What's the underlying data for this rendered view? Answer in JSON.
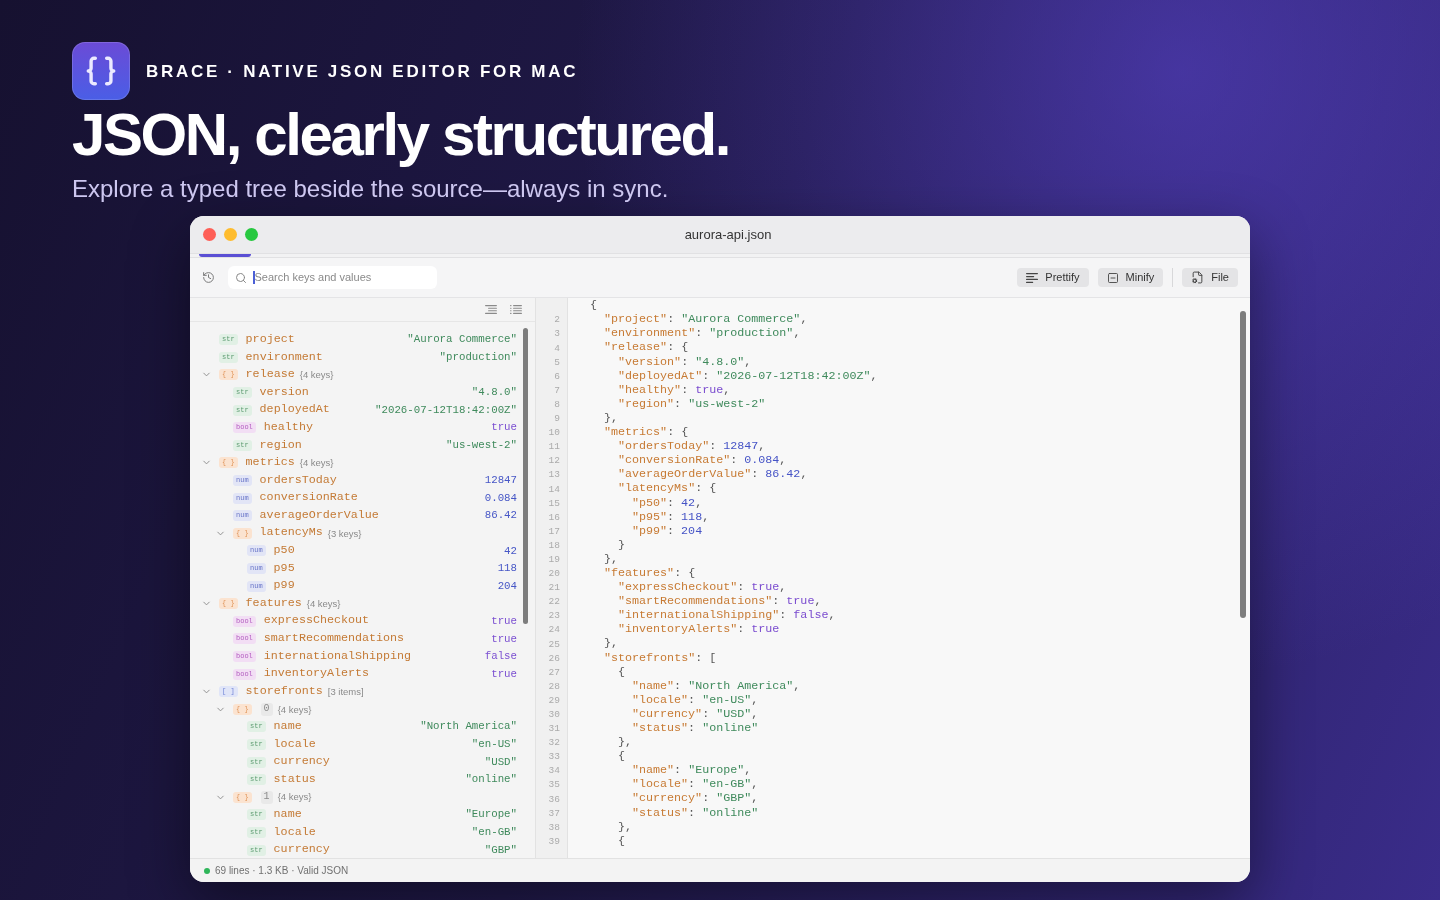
{
  "hero": {
    "brand": "BRACE · NATIVE JSON EDITOR FOR MAC",
    "headline": "JSON, clearly structured.",
    "subtitle": "Explore a typed tree beside the source—always in sync."
  },
  "window": {
    "title": "aurora-api.json"
  },
  "toolbar": {
    "search": {
      "placeholder": "Search keys and values",
      "focused": true
    },
    "buttons": [
      {
        "label": "Prettify",
        "kind": "prettify"
      },
      {
        "label": "Minify",
        "kind": "minify"
      }
    ],
    "file_button": {
      "label": "File",
      "kind": "file"
    }
  },
  "tree": {
    "items": [
      {
        "key": "project",
        "kind": "str",
        "badge": "str",
        "value": "\"Aurora Commerce\""
      },
      {
        "key": "environment",
        "kind": "str",
        "badge": "str",
        "value": "\"production\""
      },
      {
        "key": "release",
        "kind": "object",
        "badge": "{ }",
        "summary": "{4 keys}",
        "expanded": true,
        "children": [
          {
            "key": "version",
            "kind": "str",
            "badge": "str",
            "value": "\"4.8.0\""
          },
          {
            "key": "deployedAt",
            "kind": "str",
            "badge": "str",
            "value": "\"2026-07-12T18:42:00Z\""
          },
          {
            "key": "healthy",
            "kind": "bool",
            "badge": "bool",
            "value": "true"
          },
          {
            "key": "region",
            "kind": "str",
            "badge": "str",
            "value": "\"us-west-2\""
          }
        ]
      },
      {
        "key": "metrics",
        "kind": "object",
        "badge": "{ }",
        "summary": "{4 keys}",
        "expanded": true,
        "children": [
          {
            "key": "ordersToday",
            "kind": "num",
            "badge": "num",
            "value": "12847"
          },
          {
            "key": "conversionRate",
            "kind": "num",
            "badge": "num",
            "value": "0.084"
          },
          {
            "key": "averageOrderValue",
            "kind": "num",
            "badge": "num",
            "value": "86.42"
          },
          {
            "key": "latencyMs",
            "kind": "object",
            "badge": "{ }",
            "summary": "{3 keys}",
            "expanded": true,
            "children": [
              {
                "key": "p50",
                "kind": "num",
                "badge": "num",
                "value": "42"
              },
              {
                "key": "p95",
                "kind": "num",
                "badge": "num",
                "value": "118"
              },
              {
                "key": "p99",
                "kind": "num",
                "badge": "num",
                "value": "204"
              }
            ]
          }
        ]
      },
      {
        "key": "features",
        "kind": "object",
        "badge": "{ }",
        "summary": "{4 keys}",
        "expanded": true,
        "children": [
          {
            "key": "expressCheckout",
            "kind": "bool",
            "badge": "bool",
            "value": "true"
          },
          {
            "key": "smartRecommendations",
            "kind": "bool",
            "badge": "bool",
            "value": "true"
          },
          {
            "key": "internationalShipping",
            "kind": "bool",
            "badge": "bool",
            "value": "false"
          },
          {
            "key": "inventoryAlerts",
            "kind": "bool",
            "badge": "bool",
            "value": "true"
          }
        ]
      },
      {
        "key": "storefronts",
        "kind": "array",
        "badge": "[ ]",
        "summary": "[3 items]",
        "expanded": true,
        "children": [
          {
            "index": "0",
            "kind": "object",
            "badge": "{ }",
            "summary": "{4 keys}",
            "expanded": true,
            "children": [
              {
                "key": "name",
                "kind": "str",
                "badge": "str",
                "value": "\"North America\""
              },
              {
                "key": "locale",
                "kind": "str",
                "badge": "str",
                "value": "\"en-US\""
              },
              {
                "key": "currency",
                "kind": "str",
                "badge": "str",
                "value": "\"USD\""
              },
              {
                "key": "status",
                "kind": "str",
                "badge": "str",
                "value": "\"online\""
              }
            ]
          },
          {
            "index": "1",
            "kind": "object",
            "badge": "{ }",
            "summary": "{4 keys}",
            "expanded": true,
            "children": [
              {
                "key": "name",
                "kind": "str",
                "badge": "str",
                "value": "\"Europe\""
              },
              {
                "key": "locale",
                "kind": "str",
                "badge": "str",
                "value": "\"en-GB\""
              },
              {
                "key": "currency",
                "kind": "str",
                "badge": "str",
                "value": "\"GBP\""
              }
            ]
          }
        ]
      }
    ]
  },
  "code": {
    "lines": [
      {
        "tokens": [
          {
            "kind": "punct",
            "text": "{"
          }
        ],
        "children": [
          {
            "number": "2",
            "tokens": [
              {
                "kind": "key",
                "text": "\"project\""
              },
              {
                "kind": "punct",
                "text": ": "
              },
              {
                "kind": "str",
                "text": "\"Aurora Commerce\""
              },
              {
                "kind": "punct",
                "text": ","
              }
            ]
          },
          {
            "number": "3",
            "tokens": [
              {
                "kind": "key",
                "text": "\"environment\""
              },
              {
                "kind": "punct",
                "text": ": "
              },
              {
                "kind": "str",
                "text": "\"production\""
              },
              {
                "kind": "punct",
                "text": ","
              }
            ]
          },
          {
            "number": "4",
            "tokens": [
              {
                "kind": "key",
                "text": "\"release\""
              },
              {
                "kind": "punct",
                "text": ": {"
              }
            ],
            "children": [
              {
                "number": "5",
                "tokens": [
                  {
                    "kind": "key",
                    "text": "\"version\""
                  },
                  {
                    "kind": "punct",
                    "text": ": "
                  },
                  {
                    "kind": "str",
                    "text": "\"4.8.0\""
                  },
                  {
                    "kind": "punct",
                    "text": ","
                  }
                ]
              },
              {
                "number": "6",
                "tokens": [
                  {
                    "kind": "key",
                    "text": "\"deployedAt\""
                  },
                  {
                    "kind": "punct",
                    "text": ": "
                  },
                  {
                    "kind": "str",
                    "text": "\"2026-07-12T18:42:00Z\""
                  },
                  {
                    "kind": "punct",
                    "text": ","
                  }
                ]
              },
              {
                "number": "7",
                "tokens": [
                  {
                    "kind": "key",
                    "text": "\"healthy\""
                  },
                  {
                    "kind": "punct",
                    "text": ": "
                  },
                  {
                    "kind": "bool",
                    "text": "true"
                  },
                  {
                    "kind": "punct",
                    "text": ","
                  }
                ]
              },
              {
                "number": "8",
                "tokens": [
                  {
                    "kind": "key",
                    "text": "\"region\""
                  },
                  {
                    "kind": "punct",
                    "text": ": "
                  },
                  {
                    "kind": "str",
                    "text": "\"us-west-2\""
                  }
                ]
              }
            ]
          },
          {
            "number": "9",
            "tokens": [
              {
                "kind": "punct",
                "text": "},"
              }
            ]
          },
          {
            "number": "10",
            "tokens": [
              {
                "kind": "key",
                "text": "\"metrics\""
              },
              {
                "kind": "punct",
                "text": ": {"
              }
            ],
            "children": [
              {
                "number": "11",
                "tokens": [
                  {
                    "kind": "key",
                    "text": "\"ordersToday\""
                  },
                  {
                    "kind": "punct",
                    "text": ": "
                  },
                  {
                    "kind": "num",
                    "text": "12847"
                  },
                  {
                    "kind": "punct",
                    "text": ","
                  }
                ]
              },
              {
                "number": "12",
                "tokens": [
                  {
                    "kind": "key",
                    "text": "\"conversionRate\""
                  },
                  {
                    "kind": "punct",
                    "text": ": "
                  },
                  {
                    "kind": "num",
                    "text": "0.084"
                  },
                  {
                    "kind": "punct",
                    "text": ","
                  }
                ]
              },
              {
                "number": "13",
                "tokens": [
                  {
                    "kind": "key",
                    "text": "\"averageOrderValue\""
                  },
                  {
                    "kind": "punct",
                    "text": ": "
                  },
                  {
                    "kind": "num",
                    "text": "86.42"
                  },
                  {
                    "kind": "punct",
                    "text": ","
                  }
                ]
              },
              {
                "number": "14",
                "tokens": [
                  {
                    "kind": "key",
                    "text": "\"latencyMs\""
                  },
                  {
                    "kind": "punct",
                    "text": ": {"
                  }
                ],
                "children": [
                  {
                    "number": "15",
                    "tokens": [
                      {
                        "kind": "key",
                        "text": "\"p50\""
                      },
                      {
                        "kind": "punct",
                        "text": ": "
                      },
                      {
                        "kind": "num",
                        "text": "42"
                      },
                      {
                        "kind": "punct",
                        "text": ","
                      }
                    ]
                  },
                  {
                    "number": "16",
                    "tokens": [
                      {
                        "kind": "key",
                        "text": "\"p95\""
                      },
                      {
                        "kind": "punct",
                        "text": ": "
                      },
                      {
                        "kind": "num",
                        "text": "118"
                      },
                      {
                        "kind": "punct",
                        "text": ","
                      }
                    ]
                  },
                  {
                    "number": "17",
                    "tokens": [
                      {
                        "kind": "key",
                        "text": "\"p99\""
                      },
                      {
                        "kind": "punct",
                        "text": ": "
                      },
                      {
                        "kind": "num",
                        "text": "204"
                      }
                    ]
                  }
                ]
              },
              {
                "number": "18",
                "tokens": [
                  {
                    "kind": "punct",
                    "text": "}"
                  }
                ]
              }
            ]
          },
          {
            "number": "19",
            "tokens": [
              {
                "kind": "punct",
                "text": "},"
              }
            ]
          },
          {
            "number": "20",
            "tokens": [
              {
                "kind": "key",
                "text": "\"features\""
              },
              {
                "kind": "punct",
                "text": ": {"
              }
            ],
            "children": [
              {
                "number": "21",
                "tokens": [
                  {
                    "kind": "key",
                    "text": "\"expressCheckout\""
                  },
                  {
                    "kind": "punct",
                    "text": ": "
                  },
                  {
                    "kind": "bool",
                    "text": "true"
                  },
                  {
                    "kind": "punct",
                    "text": ","
                  }
                ]
              },
              {
                "number": "22",
                "tokens": [
                  {
                    "kind": "key",
                    "text": "\"smartRecommendations\""
                  },
                  {
                    "kind": "punct",
                    "text": ": "
                  },
                  {
                    "kind": "bool",
                    "text": "true"
                  },
                  {
                    "kind": "punct",
                    "text": ","
                  }
                ]
              },
              {
                "number": "23",
                "tokens": [
                  {
                    "kind": "key",
                    "text": "\"internationalShipping\""
                  },
                  {
                    "kind": "punct",
                    "text": ": "
                  },
                  {
                    "kind": "bool",
                    "text": "false"
                  },
                  {
                    "kind": "punct",
                    "text": ","
                  }
                ]
              },
              {
                "number": "24",
                "tokens": [
                  {
                    "kind": "key",
                    "text": "\"inventoryAlerts\""
                  },
                  {
                    "kind": "punct",
                    "text": ": "
                  },
                  {
                    "kind": "bool",
                    "text": "true"
                  }
                ]
              }
            ]
          },
          {
            "number": "25",
            "tokens": [
              {
                "kind": "punct",
                "text": "},"
              }
            ]
          },
          {
            "number": "26",
            "tokens": [
              {
                "kind": "key",
                "text": "\"storefronts\""
              },
              {
                "kind": "punct",
                "text": ": ["
              }
            ],
            "children": [
              {
                "number": "27",
                "tokens": [
                  {
                    "kind": "punct",
                    "text": "{"
                  }
                ],
                "children": [
                  {
                    "number": "28",
                    "tokens": [
                      {
                        "kind": "key",
                        "text": "\"name\""
                      },
                      {
                        "kind": "punct",
                        "text": ": "
                      },
                      {
                        "kind": "str",
                        "text": "\"North America\""
                      },
                      {
                        "kind": "punct",
                        "text": ","
                      }
                    ]
                  },
                  {
                    "number": "29",
                    "tokens": [
                      {
                        "kind": "key",
                        "text": "\"locale\""
                      },
                      {
                        "kind": "punct",
                        "text": ": "
                      },
                      {
                        "kind": "str",
                        "text": "\"en-US\""
                      },
                      {
                        "kind": "punct",
                        "text": ","
                      }
                    ]
                  },
                  {
                    "number": "30",
                    "tokens": [
                      {
                        "kind": "key",
                        "text": "\"currency\""
                      },
                      {
                        "kind": "punct",
                        "text": ": "
                      },
                      {
                        "kind": "str",
                        "text": "\"USD\""
                      },
                      {
                        "kind": "punct",
                        "text": ","
                      }
                    ]
                  },
                  {
                    "number": "31",
                    "tokens": [
                      {
                        "kind": "key",
                        "text": "\"status\""
                      },
                      {
                        "kind": "punct",
                        "text": ": "
                      },
                      {
                        "kind": "str",
                        "text": "\"online\""
                      }
                    ]
                  }
                ]
              },
              {
                "number": "32",
                "tokens": [
                  {
                    "kind": "punct",
                    "text": "},"
                  }
                ]
              },
              {
                "number": "33",
                "tokens": [
                  {
                    "kind": "punct",
                    "text": "{"
                  }
                ],
                "children": [
                  {
                    "number": "34",
                    "tokens": [
                      {
                        "kind": "key",
                        "text": "\"name\""
                      },
                      {
                        "kind": "punct",
                        "text": ": "
                      },
                      {
                        "kind": "str",
                        "text": "\"Europe\""
                      },
                      {
                        "kind": "punct",
                        "text": ","
                      }
                    ]
                  },
                  {
                    "number": "35",
                    "tokens": [
                      {
                        "kind": "key",
                        "text": "\"locale\""
                      },
                      {
                        "kind": "punct",
                        "text": ": "
                      },
                      {
                        "kind": "str",
                        "text": "\"en-GB\""
                      },
                      {
                        "kind": "punct",
                        "text": ","
                      }
                    ]
                  },
                  {
                    "number": "36",
                    "tokens": [
                      {
                        "kind": "key",
                        "text": "\"currency\""
                      },
                      {
                        "kind": "punct",
                        "text": ": "
                      },
                      {
                        "kind": "str",
                        "text": "\"GBP\""
                      },
                      {
                        "kind": "punct",
                        "text": ","
                      }
                    ]
                  },
                  {
                    "number": "37",
                    "tokens": [
                      {
                        "kind": "key",
                        "text": "\"status\""
                      },
                      {
                        "kind": "punct",
                        "text": ": "
                      },
                      {
                        "kind": "str",
                        "text": "\"online\""
                      }
                    ]
                  }
                ]
              },
              {
                "number": "38",
                "tokens": [
                  {
                    "kind": "punct",
                    "text": "},"
                  }
                ]
              },
              {
                "number": "39",
                "tokens": [
                  {
                    "kind": "punct",
                    "text": "{"
                  }
                ]
              }
            ]
          }
        ]
      }
    ]
  },
  "status_bar": {
    "text": "69 lines · 1.3 KB · Valid JSON",
    "valid": true
  }
}
